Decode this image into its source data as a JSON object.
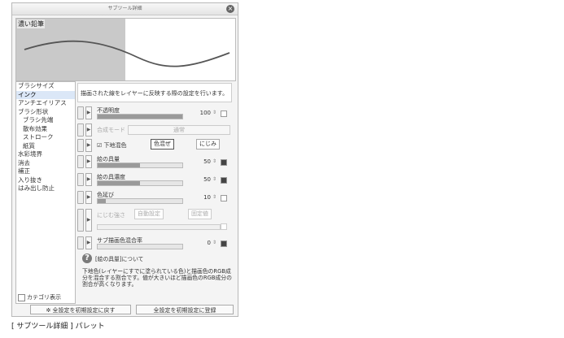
{
  "window": {
    "title": "サブツール詳細",
    "brush_name": "濃い鉛筆"
  },
  "categories": [
    {
      "label": "ブラシサイズ",
      "sub": false,
      "selected": false
    },
    {
      "label": "インク",
      "sub": false,
      "selected": true
    },
    {
      "label": "アンチエイリアス",
      "sub": false,
      "selected": false
    },
    {
      "label": "ブラシ形状",
      "sub": false,
      "selected": false
    },
    {
      "label": "ブラシ先端",
      "sub": true,
      "selected": false
    },
    {
      "label": "散布効果",
      "sub": true,
      "selected": false
    },
    {
      "label": "ストローク",
      "sub": true,
      "selected": false
    },
    {
      "label": "紙質",
      "sub": true,
      "selected": false
    },
    {
      "label": "水彩境界",
      "sub": false,
      "selected": false
    },
    {
      "label": "消去",
      "sub": false,
      "selected": false
    },
    {
      "label": "補正",
      "sub": false,
      "selected": false
    },
    {
      "label": "入り抜き",
      "sub": false,
      "selected": false
    },
    {
      "label": "はみ出し防止",
      "sub": false,
      "selected": false
    }
  ],
  "category_display_label": "カテゴリ表示",
  "description": "描画された線をレイヤーに反映する際の設定を行います。",
  "settings": {
    "opacity": {
      "label": "不透明度",
      "value": "100",
      "level": 1.0
    },
    "blend_mode": {
      "label": "合成モード",
      "value": "通常"
    },
    "underlay": {
      "label": "下地混色",
      "opt1": "色混ぜ",
      "opt2": "にじみ"
    },
    "paint_amount": {
      "label": "絵の具量",
      "value": "50",
      "level": 0.5
    },
    "paint_density": {
      "label": "絵の具濃度",
      "value": "50",
      "level": 0.5
    },
    "color_stretch": {
      "label": "色延び",
      "value": "10",
      "level": 0.1
    },
    "blur": {
      "label": "にじむ強さ",
      "auto": "自動設定",
      "fixed": "固定値"
    },
    "sub_color_mix": {
      "label": "サブ描画色混合率",
      "value": "0",
      "level": 0.0
    }
  },
  "help": {
    "icon": "?",
    "title": "[絵の具量]について",
    "body": "下地色(レイヤーにすでに塗られている色)と描画色のRGB成分を混合する割合です。値が大きいほど描画色のRGB成分の割合が高くなります。"
  },
  "buttons": {
    "reset_all": "全設定を初期設定に戻す",
    "register_all": "全設定を初期設定に登録"
  },
  "caption": "[ サブツール詳細 ] パレット"
}
